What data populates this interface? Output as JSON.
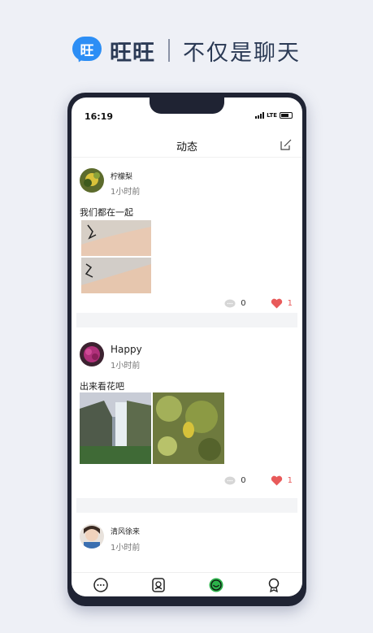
{
  "brand": {
    "logo_char": "旺",
    "name": "旺旺",
    "slogan": "不仅是聊天"
  },
  "status_bar": {
    "time": "16:19",
    "network": "LTE"
  },
  "nav": {
    "title": "动态"
  },
  "posts": [
    {
      "user": "柠檬梨",
      "time": "1小时前",
      "text": "我们都在一起",
      "comments": "0",
      "likes": "1"
    },
    {
      "user": "Happy",
      "time": "1小时前",
      "text": "出来看花吧",
      "comments": "0",
      "likes": "1"
    },
    {
      "user": "清风徐来",
      "time": "1小时前"
    }
  ],
  "tabs": [
    "chat-icon",
    "contacts-icon",
    "moments-icon",
    "profile-icon"
  ],
  "colors": {
    "brand_blue": "#2c8ef5",
    "like_red": "#e85a5a",
    "active_green": "#2cb24a"
  }
}
